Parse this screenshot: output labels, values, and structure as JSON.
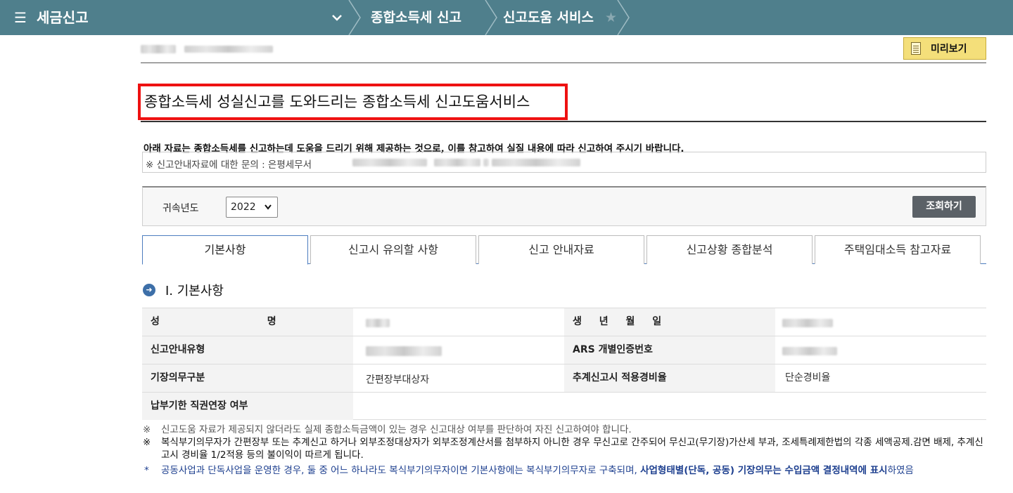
{
  "topbar": {
    "menu_icon": "hamburger-icon",
    "title": "세금신고",
    "breadcrumbs": [
      "종합소득세 신고",
      "신고도움 서비스"
    ]
  },
  "header": {
    "preview_label": "미리보기"
  },
  "heading": "종합소득세 성실신고를 도와드리는 종합소득세 신고도움서비스",
  "notice": {
    "main": "아래 자료는 종합소득세를 신고하는데 도움을 드리기 위해 제공하는 것으로, 이를 참고하여 실질 내용에 따라 신고하여 주시기 바랍니다.",
    "inquiry": "※ 신고안내자료에 대한 문의 : 은평세무서"
  },
  "search": {
    "year_label": "귀속년도",
    "year_value": "2022",
    "button_label": "조회하기"
  },
  "tabs": [
    "기본사항",
    "신고시 유의할 사항",
    "신고 안내자료",
    "신고상황 종합분석",
    "주택임대소득 참고자료"
  ],
  "section": {
    "title": "Ⅰ. 기본사항"
  },
  "info": {
    "name_label": "성 명",
    "birth_label": "생 년 월 일",
    "type_label": "신고안내유형",
    "ars_label": "ARS 개별인증번호",
    "bookkeeping_label": "기장의무구분",
    "bookkeeping_value": "간편장부대상자",
    "rate_label": "추계신고시 적용경비율",
    "rate_value": "단순경비율",
    "deadline_label": "납부기한 직권연장 여부"
  },
  "notes": {
    "note1_mark": "※",
    "note1": "신고도움 자료가 제공되지 않더라도 실제 종합소득금액이 있는 경우 신고대상 여부를 판단하여 자진 신고하여야 합니다.",
    "note2_mark": "※",
    "note2": "복식부기의무자가 간편장부 또는 추계신고 하거나 외부조정대상자가 외부조정계산서를 첨부하지 아니한 경우 무신고로 간주되어 무신고(무기장)가산세 부과, 조세특례제한법의 각종 세액공제.감면 배제, 추계신고시 경비율 1/2적용 등의 불이익이 따르게 됩니다.",
    "note3_mark": "*",
    "note3_plain": "공동사업과 단독사업을 운영한 경우, 둘 중 어느 하나라도 복식부기의무자이면 기본사항에는 복식부기의무자로 구축되며,",
    "note3_bold": "사업형태별(단독, 공동) 기장의무는 수입금액 결정내역에 표시",
    "note3_tail": "하였음"
  }
}
